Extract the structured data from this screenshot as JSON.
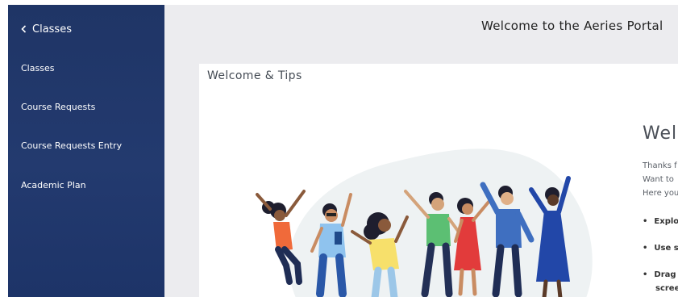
{
  "sidebar": {
    "back_label": "Classes",
    "items": [
      {
        "label": "Classes"
      },
      {
        "label": "Course Requests"
      },
      {
        "label": "Course Requests Entry"
      },
      {
        "label": "Academic Plan"
      }
    ]
  },
  "header": {
    "title": "Welcome to the Aeries Portal"
  },
  "card": {
    "title": "Welcome & Tips",
    "heading": "Wel",
    "paragraph_lines": [
      "Thanks f",
      "Want to",
      "Here you"
    ],
    "bullets": [
      "Explo",
      "Use s",
      "Drag",
      "scree"
    ]
  },
  "colors": {
    "sidebar_bg": "#233a6f",
    "main_bg": "#ececef",
    "card_bg": "#ffffff",
    "blob": "#eef2f3"
  },
  "icons": {
    "back": "chevron-left-icon"
  }
}
